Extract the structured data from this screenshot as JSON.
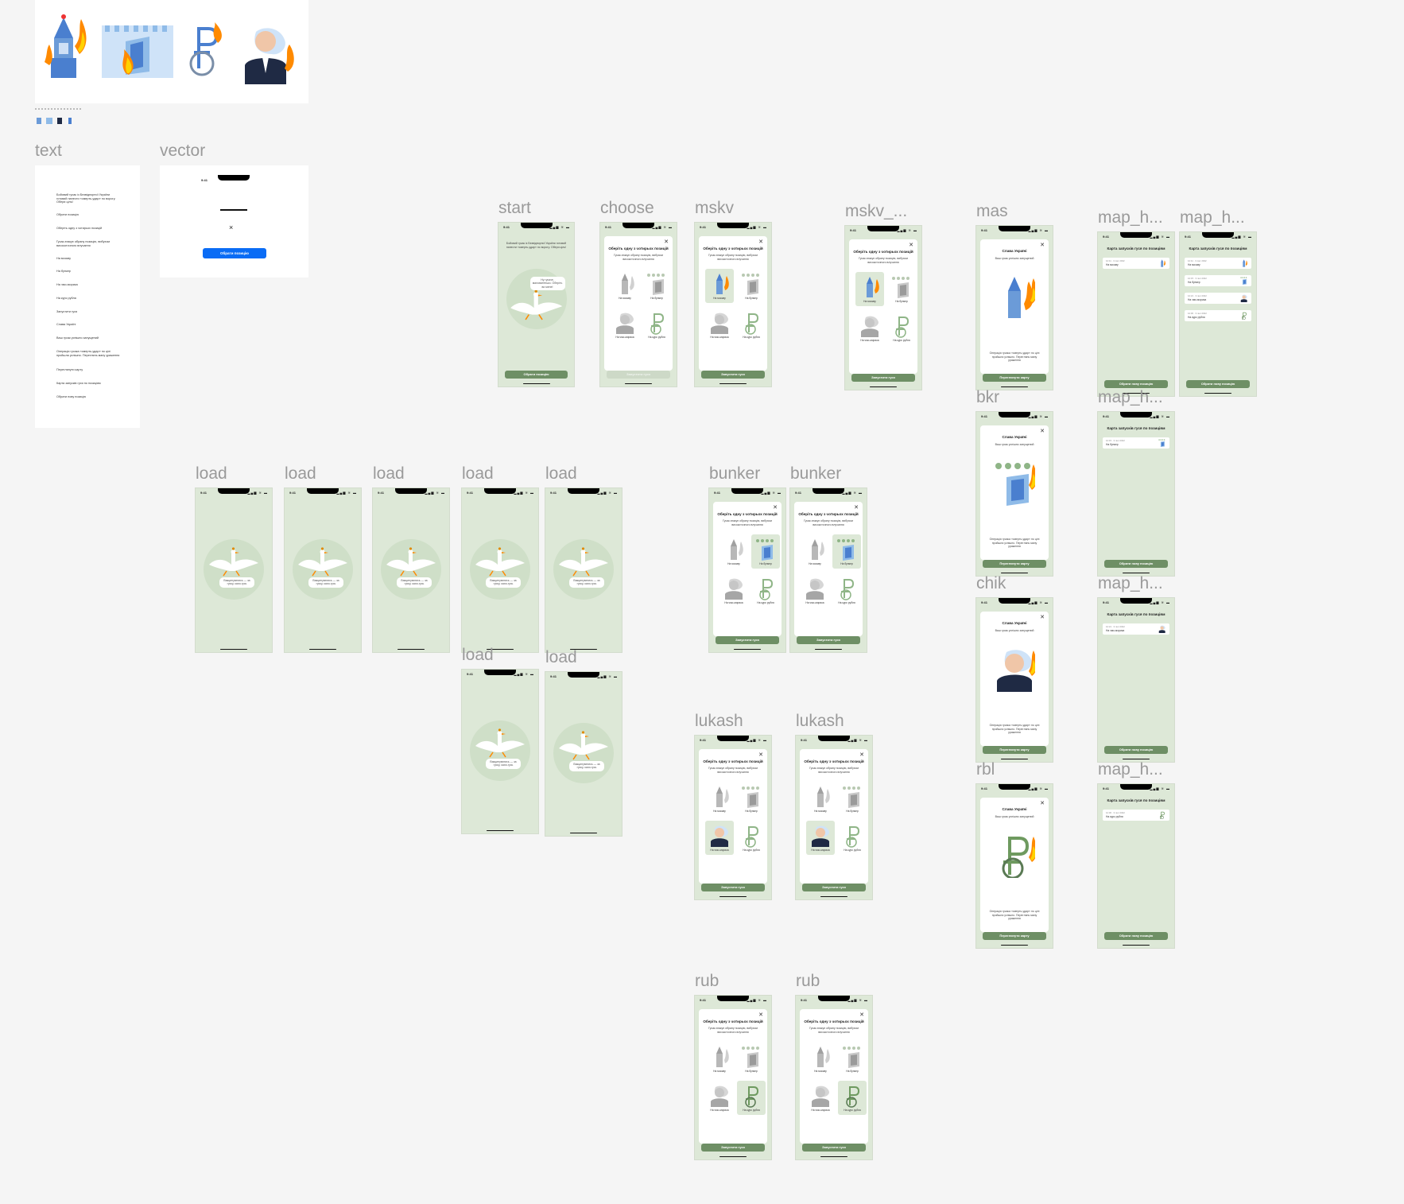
{
  "frame_labels": {
    "text": "text",
    "vector": "vector",
    "start": "start",
    "choose": "choose",
    "mskv": "mskv",
    "mskv2": "mskv_...",
    "mas": "mas",
    "bkr": "bkr",
    "chik": "chik",
    "rbl": "rbl",
    "map_h": "map_h...",
    "load": "load",
    "bunker": "bunker",
    "lukash": "lukash",
    "rub": "rub"
  },
  "status": {
    "time": "9:41",
    "signal": "▂▄▆ ≋ ▬"
  },
  "start": {
    "intro": "Бойовий гусак із Безвідпорної України готовий нанести «смерть-удар» по ворогу. Обери ціль!",
    "bubble": "Ну гусаче, маловатенько. Оберіть ви мене!",
    "button": "Обрати позицію"
  },
  "choose": {
    "title": "Оберіть одну з чотирьох позицій",
    "subtitle": "Гусак атакує обрану позицію, вибухом високоточного влучання",
    "options": [
      "На москву",
      "На бункер",
      "На чмо-морика",
      "На курс рубля"
    ],
    "button": "Запустити гуся"
  },
  "result": {
    "title": "Слава Україні",
    "subtitle": "Ваш гусак успішно запущений",
    "caption": "Операція гусака «смерть-удар» по цілі пройшла успішно. Переглянь мапу ураження",
    "button": "Переглянути карту"
  },
  "map": {
    "title": "Карта запусків гуся по позиціям",
    "rows": [
      {
        "date": "12:11 · 3 лют 2022",
        "label": "На москву"
      },
      {
        "date": "12:15 · 3 лют 2022",
        "label": "На бункер"
      },
      {
        "date": "12:21 · 3 лют 2022",
        "label": "На чмо-морика"
      },
      {
        "date": "12:30 · 3 лют 2022",
        "label": "На курс рубля"
      }
    ],
    "button": "Обрати нову позицію"
  },
  "load": {
    "bubble": "Вакцинуватись — за гуску, кахи-гусь"
  },
  "vector": {
    "time": "9:41",
    "close": "×",
    "button": "Обрати позицію"
  },
  "text_lines": [
    "Бойовий гусак із Безвідпорної України готовий нанести «смерть-удар» по ворогу. Обери ціль!",
    "Обрати позицію",
    "Оберіть одну з чотирьох позицій",
    "Гусак атакує обрану позицію, вибухом високоточного влучання",
    "На москву",
    "На бункер",
    "На чмо-морика",
    "На курс рубля",
    "Запустити гуся",
    "Слава Україні",
    "Ваш гусак успішно запущений",
    "Операція гусака «смерть-удар» по цілі пройшла успішно. Переглянь мапу ураження",
    "Переглянути карту",
    "Карта запусків гуся по позиціям",
    "Обрати нову позицію"
  ],
  "icons": [
    "kremlin-fire-icon",
    "bunker-fire-icon",
    "ruble-wheelchair-icon",
    "dictator-fire-icon"
  ]
}
